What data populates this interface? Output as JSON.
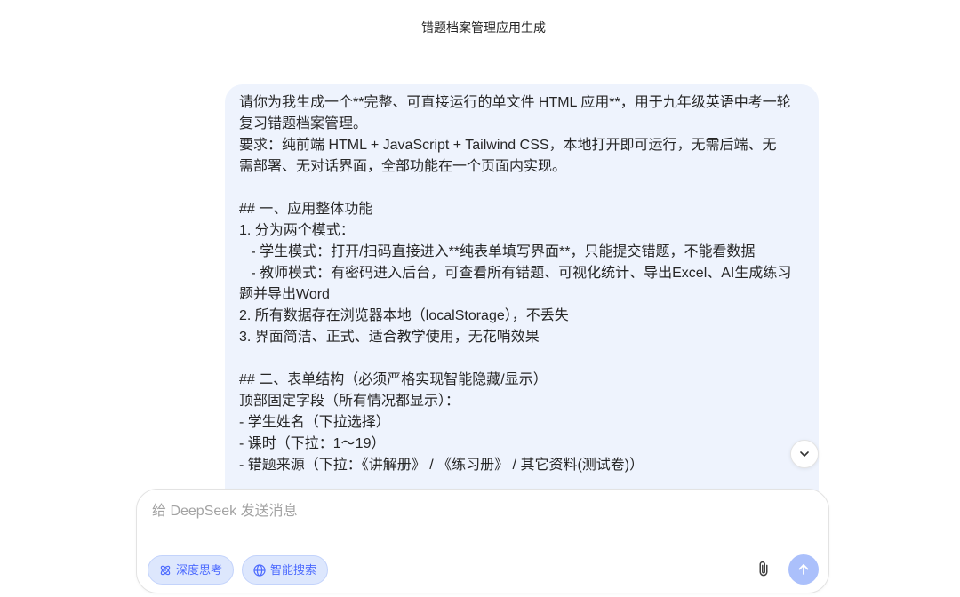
{
  "conversation": {
    "title": "错题档案管理应用生成"
  },
  "message": {
    "lines": [
      "请你为我生成一个**完整、可直接运行的单文件 HTML 应用**，用于九年级英语中考一轮",
      "复习错题档案管理。",
      "要求：纯前端 HTML + JavaScript + Tailwind CSS，本地打开即可运行，无需后端、无",
      "需部署、无对话界面，全部功能在一个页面内实现。",
      "",
      "## 一、应用整体功能",
      "1. 分为两个模式：",
      "   - 学生模式：打开/扫码直接进入**纯表单填写界面**，只能提交错题，不能看数据",
      "   - 教师模式：有密码进入后台，可查看所有错题、可视化统计、导出Excel、AI生成练习",
      "题并导出Word",
      "2. 所有数据存在浏览器本地（localStorage），不丢失",
      "3. 界面简洁、正式、适合教学使用，无花哨效果",
      "",
      "## 二、表单结构（必须严格实现智能隐藏/显示）",
      "顶部固定字段（所有情况都显示）：",
      "- 学生姓名（下拉选择）",
      "- 课时（下拉：1～19）",
      "- 错题来源（下拉：《讲解册》 / 《练习册》 / 其它资料(测试卷)）"
    ]
  },
  "composer": {
    "placeholder": "给 DeepSeek 发送消息",
    "deep_think": {
      "label": "深度思考",
      "icon": "deep-think-icon"
    },
    "search": {
      "label": "智能搜索",
      "icon": "globe-icon"
    },
    "attach_icon": "paperclip-icon",
    "send_icon": "arrow-up-icon"
  },
  "scroll_to_bottom": {
    "icon": "chevron-down-icon"
  },
  "colors": {
    "page_background": "#ffffff",
    "user_bubble": "#eef3fd",
    "text": "#262626",
    "accent": "#4d6bfe",
    "pill_background": "#dde7fd",
    "send_button_disabled": "#abc0fb",
    "placeholder": "#a3a3a3"
  }
}
